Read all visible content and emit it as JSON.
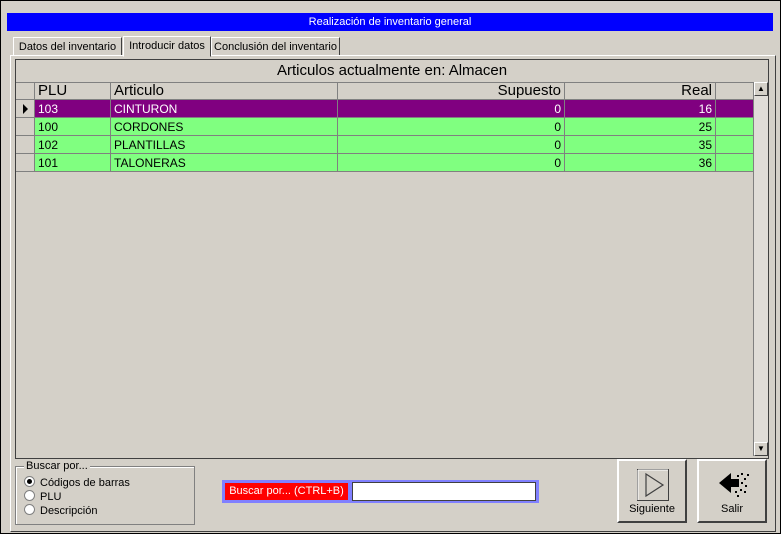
{
  "window": {
    "title": "Realización de inventario general"
  },
  "tabs": [
    {
      "label": "Datos del inventario"
    },
    {
      "label": "Introducir datos"
    },
    {
      "label": "Conclusión del inventario"
    }
  ],
  "grid": {
    "caption": "Articulos actualmente en: Almacen",
    "columns": {
      "plu": "PLU",
      "articulo": "Articulo",
      "supuesto": "Supuesto",
      "real": "Real"
    },
    "rows": [
      {
        "plu": "103",
        "articulo": "CINTURON",
        "supuesto": "0",
        "real": "16"
      },
      {
        "plu": "100",
        "articulo": "CORDONES",
        "supuesto": "0",
        "real": "25"
      },
      {
        "plu": "102",
        "articulo": "PLANTILLAS",
        "supuesto": "0",
        "real": "35"
      },
      {
        "plu": "101",
        "articulo": "TALONERAS",
        "supuesto": "0",
        "real": "36"
      }
    ]
  },
  "search_by": {
    "legend": "Buscar por...",
    "options": [
      {
        "label": "Códigos de barras",
        "selected": true
      },
      {
        "label": "PLU",
        "selected": false
      },
      {
        "label": "Descripción",
        "selected": false
      }
    ]
  },
  "search": {
    "label": "Buscar por... (CTRL+B)",
    "value": ""
  },
  "buttons": {
    "next": "Siguiente",
    "exit": "Salir"
  },
  "colors": {
    "title_bar": "#0000ff",
    "selected_row": "#800080",
    "row": "#80ff80",
    "search_label": "#ff0000"
  }
}
